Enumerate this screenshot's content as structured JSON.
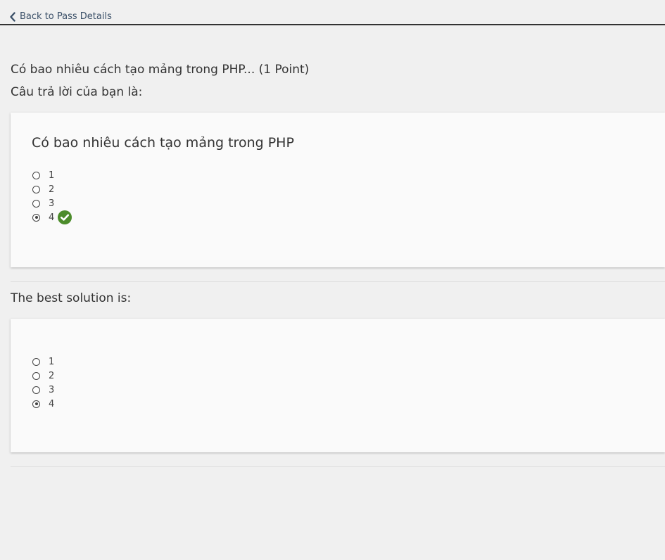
{
  "nav": {
    "back_label": "Back to Pass Details",
    "back_icon": "chevron-left-icon"
  },
  "question": {
    "title": "Có bao nhiêu cách tạo mảng trong PHP... (1 Point)",
    "answer_label": "Câu trả lời của bạn là:"
  },
  "user_answer": {
    "question_text": "Có bao nhiêu cách tạo mảng trong PHP",
    "options": [
      {
        "label": "1",
        "selected": false
      },
      {
        "label": "2",
        "selected": false
      },
      {
        "label": "3",
        "selected": false
      },
      {
        "label": "4",
        "selected": true,
        "correct_icon": "check-circle-icon"
      }
    ],
    "correct_color": "#4c8c2b"
  },
  "best_solution": {
    "label": "The best solution is:",
    "options": [
      {
        "label": "1",
        "selected": false
      },
      {
        "label": "2",
        "selected": false
      },
      {
        "label": "3",
        "selected": false
      },
      {
        "label": "4",
        "selected": true
      }
    ]
  }
}
